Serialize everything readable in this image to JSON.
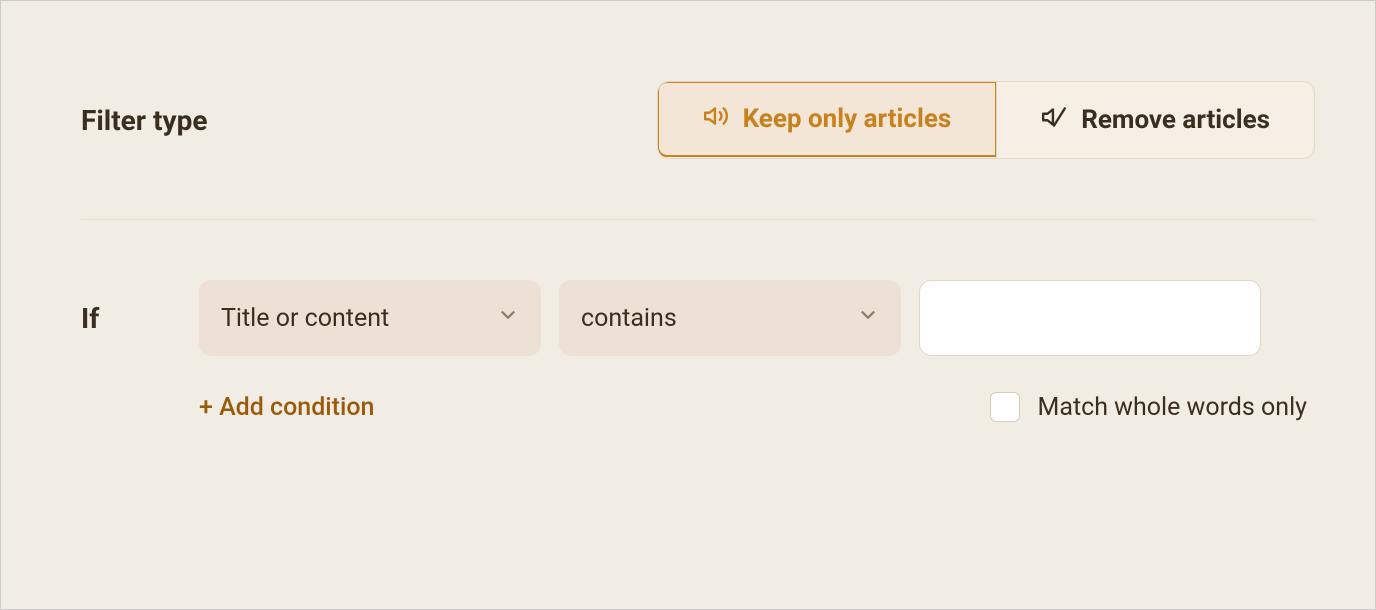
{
  "filter_type": {
    "label": "Filter type",
    "options": {
      "keep": "Keep only articles",
      "remove": "Remove articles"
    },
    "selected": "keep"
  },
  "condition": {
    "if_label": "If",
    "field": "Title or content",
    "operator": "contains",
    "value": ""
  },
  "add_condition_label": "+ Add condition",
  "match_whole_words": {
    "label": "Match whole words only",
    "checked": false
  }
}
